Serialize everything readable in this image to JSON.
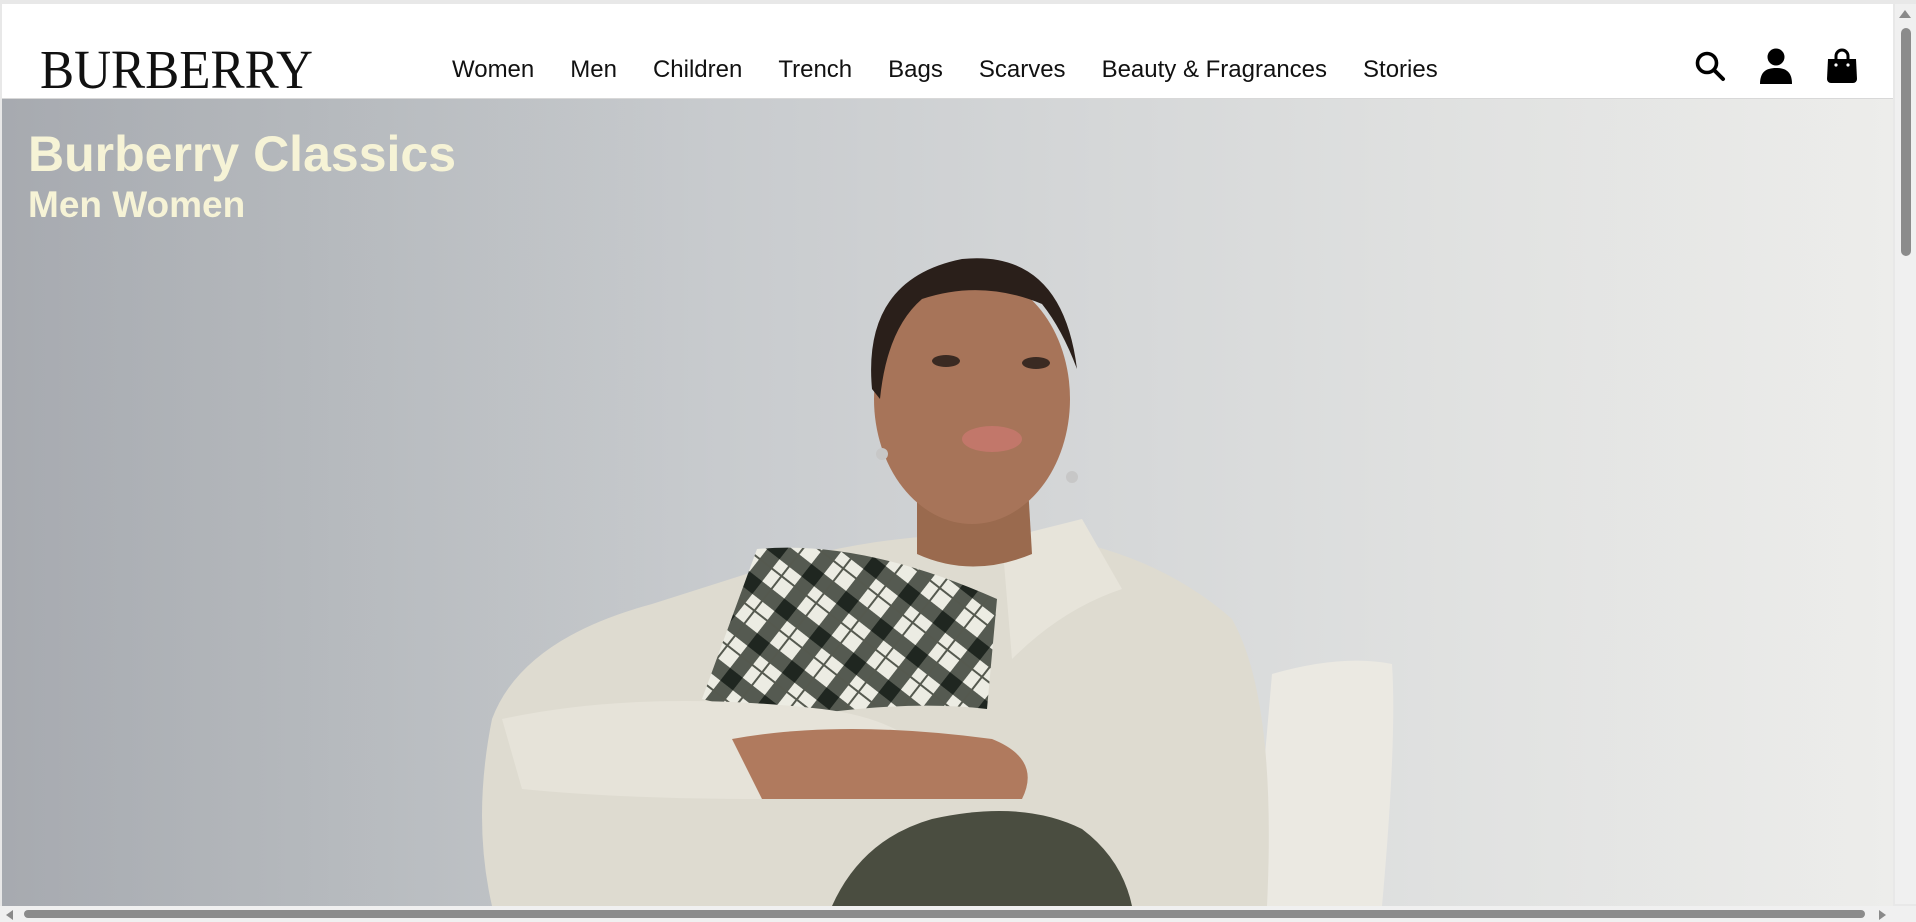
{
  "header": {
    "logo": "BURBERRY",
    "nav": [
      "Women",
      "Men",
      "Children",
      "Trench",
      "Bags",
      "Scarves",
      "Beauty & Fragrances",
      "Stories"
    ],
    "icons": [
      "search-icon",
      "account-icon",
      "shopping-bag-icon"
    ]
  },
  "hero": {
    "title": "Burberry Classics",
    "links": [
      "Men",
      "Women"
    ]
  },
  "colors": {
    "hero_text": "#f6f3d6",
    "nav_text": "#111111"
  }
}
